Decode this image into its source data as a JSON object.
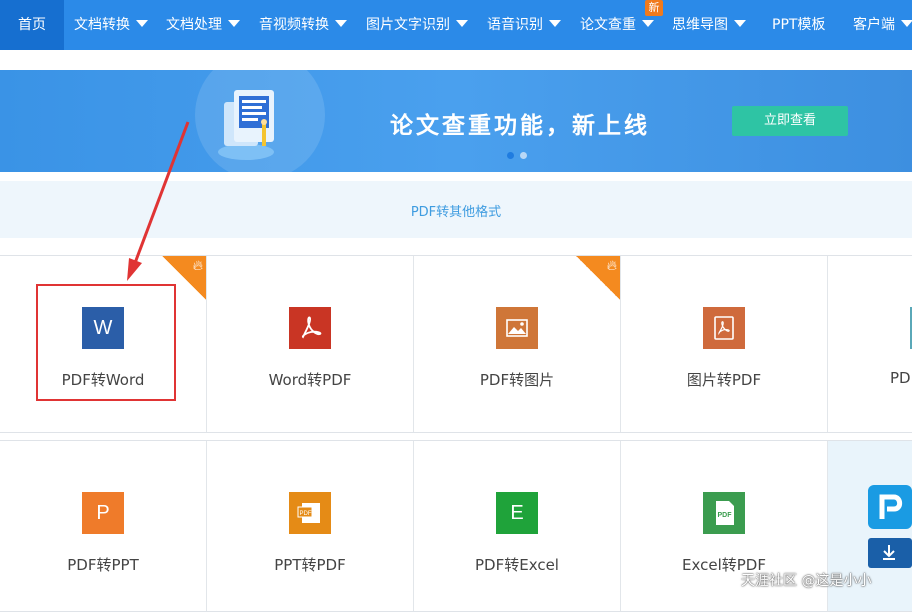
{
  "nav": {
    "home": "首页",
    "items": [
      "文档转换",
      "文档处理",
      "音视频转换",
      "图片文字识别",
      "语音识别",
      "论文查重",
      "思维导图",
      "PPT模板",
      "客户端"
    ],
    "new_badge": "新"
  },
  "banner": {
    "title": "论文查重功能，新上线",
    "button": "立即查看"
  },
  "subheader": "PDF转其他格式",
  "tools_row1": [
    {
      "label": "PDF转Word",
      "icon_char": "W",
      "icon": "word-icon",
      "color": "#2b5ea8"
    },
    {
      "label": "Word转PDF",
      "icon_char": "",
      "icon": "acrobat-icon",
      "color": "#c93524"
    },
    {
      "label": "PDF转图片",
      "icon_char": "",
      "icon": "image-icon",
      "color": "#cf7638"
    },
    {
      "label": "图片转PDF",
      "icon_char": "",
      "icon": "pdf-doc-icon",
      "color": "#cf6a3c"
    },
    {
      "label": "PD",
      "icon_char": "",
      "icon": "partial-icon",
      "color": "#5aa8b8"
    }
  ],
  "tools_row2": [
    {
      "label": "PDF转PPT",
      "icon_char": "P",
      "icon": "powerpoint-icon",
      "color": "#ef7b2a"
    },
    {
      "label": "PPT转PDF",
      "icon_char": "",
      "icon": "ppt-pdf-icon",
      "color": "#e58b16"
    },
    {
      "label": "PDF转Excel",
      "icon_char": "E",
      "icon": "excel-icon",
      "color": "#1fa33a"
    },
    {
      "label": "Excel转PDF",
      "icon_char": "",
      "icon": "excel-pdf-icon",
      "color": "#3b9c4f"
    }
  ],
  "watermark": "天涯社区 @这是小小",
  "colors": {
    "nav": "#2b8ae8",
    "nav_active": "#166fd0",
    "accent": "#2ec4a4",
    "highlight": "#e03434",
    "hot": "#f48a1f"
  }
}
